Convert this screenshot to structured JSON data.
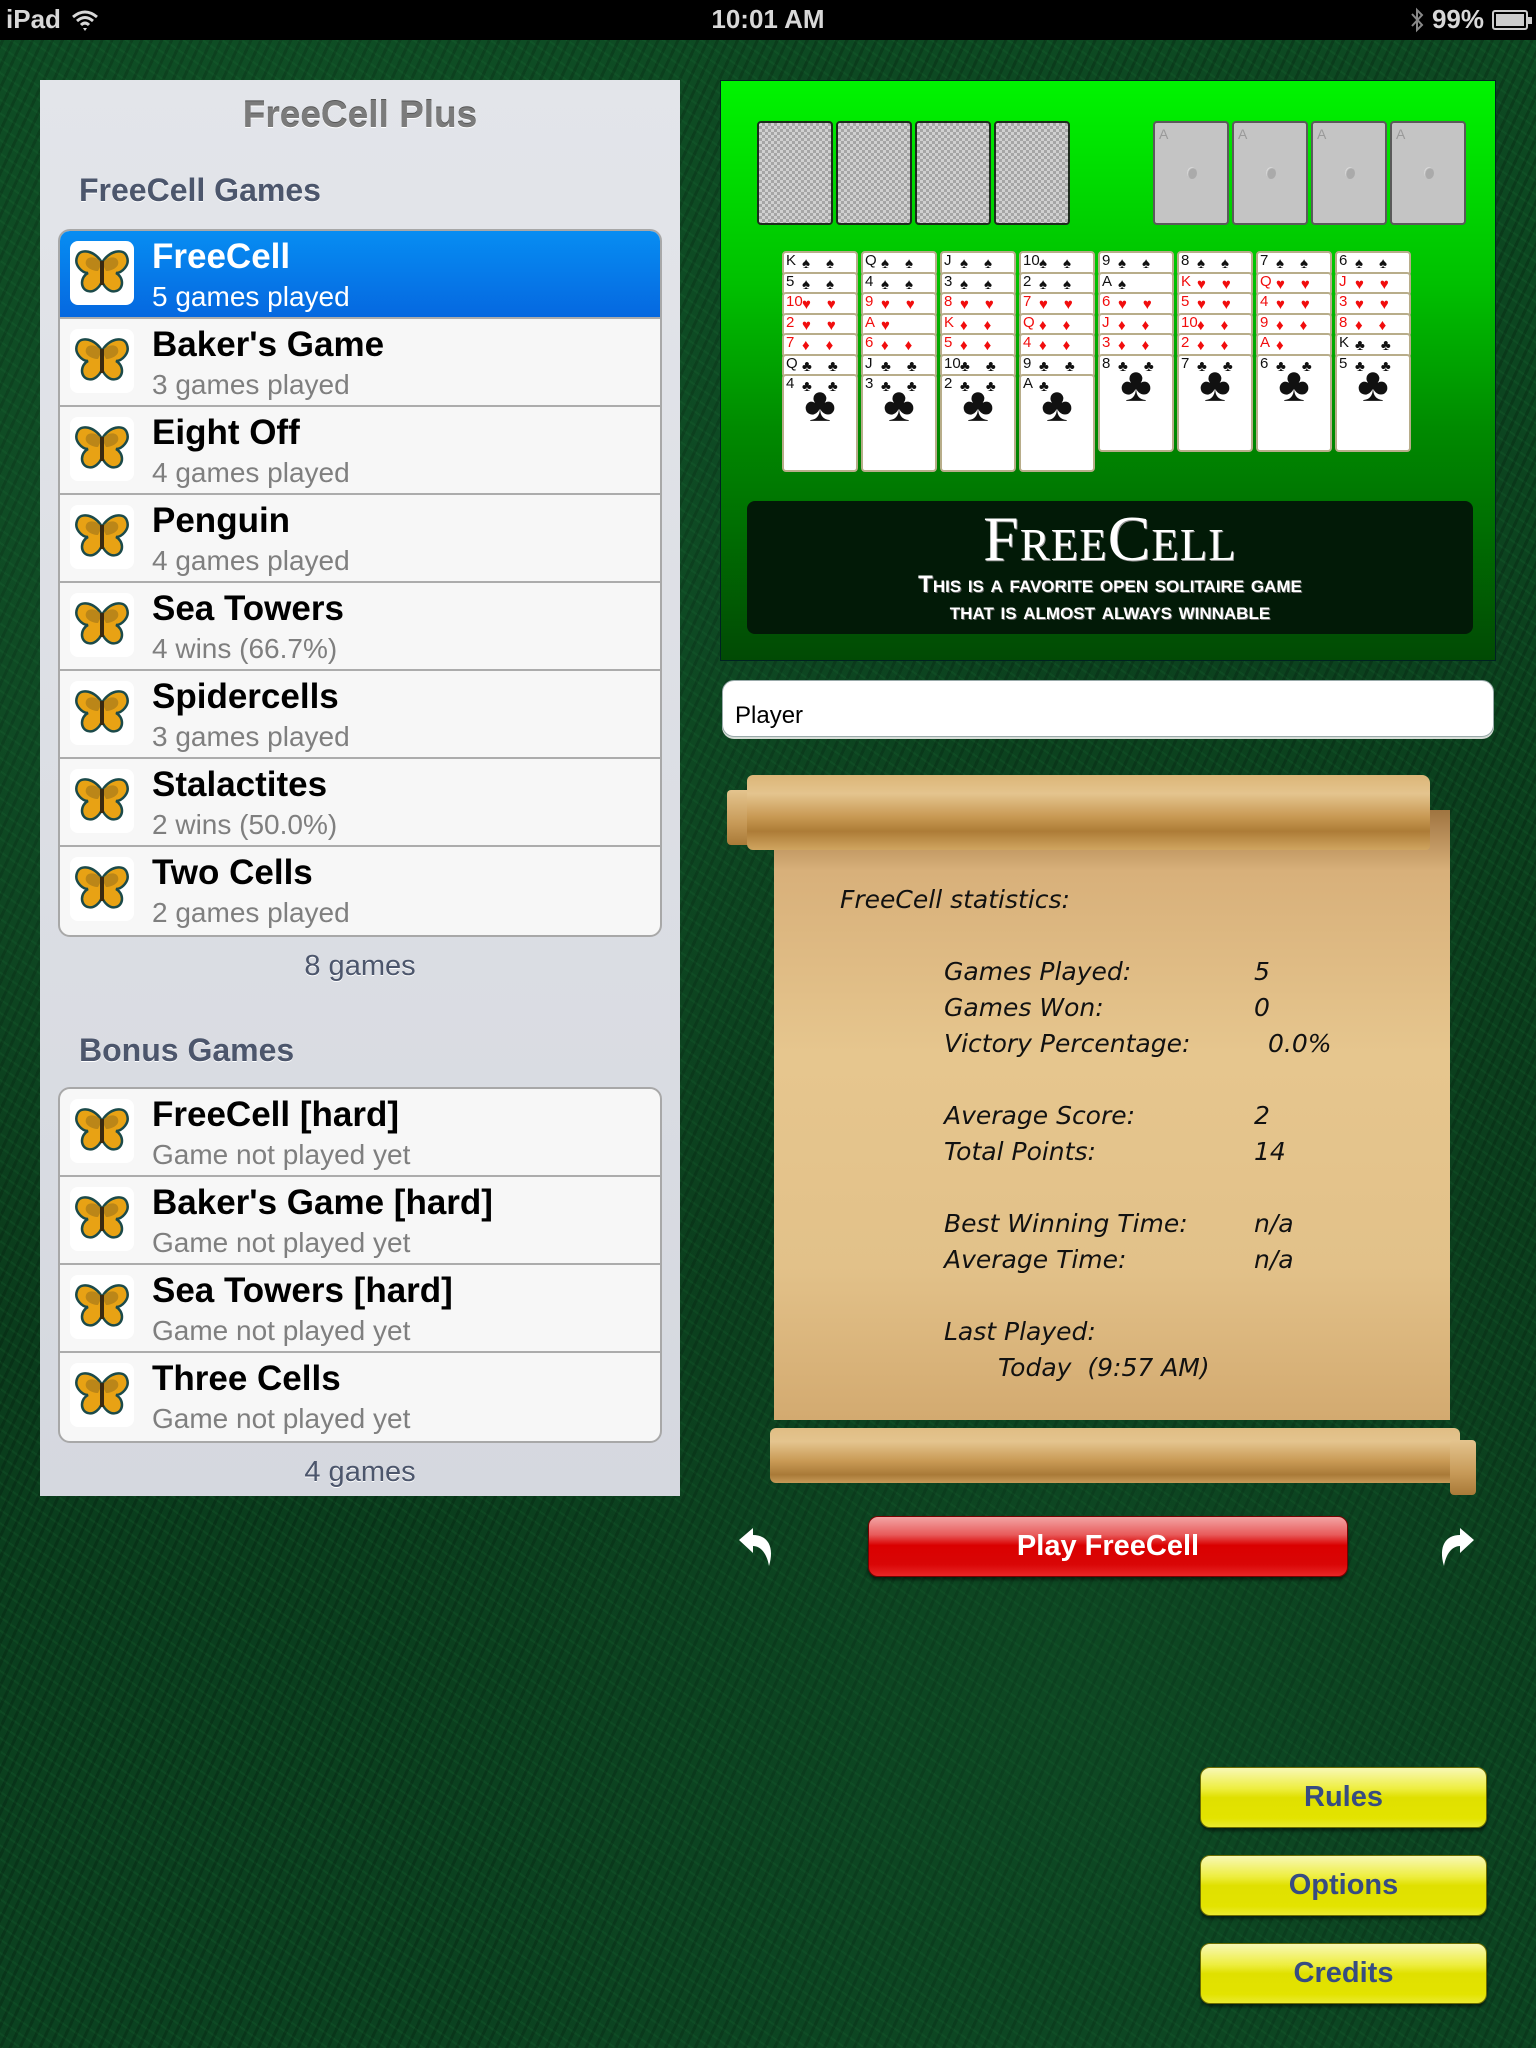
{
  "status_bar": {
    "device": "iPad",
    "time": "10:01 AM",
    "battery": "99%",
    "battery_level": 0.99,
    "icons": [
      "wifi-icon",
      "bluetooth-icon",
      "battery-icon"
    ]
  },
  "panel": {
    "title": "FreeCell Plus",
    "sections": [
      {
        "header": "FreeCell Games",
        "footer": "8 games",
        "items": [
          {
            "name": "FreeCell",
            "detail": "5 games played",
            "selected": true,
            "icon": "butterfly-icon"
          },
          {
            "name": "Baker's Game",
            "detail": "3 games played",
            "selected": false,
            "icon": "butterfly-icon"
          },
          {
            "name": "Eight Off",
            "detail": "4 games played",
            "selected": false,
            "icon": "butterfly-icon"
          },
          {
            "name": "Penguin",
            "detail": "4 games played",
            "selected": false,
            "icon": "butterfly-icon"
          },
          {
            "name": "Sea Towers",
            "detail": "4 wins (66.7%)",
            "selected": false,
            "icon": "butterfly-icon"
          },
          {
            "name": "Spidercells",
            "detail": "3 games played",
            "selected": false,
            "icon": "butterfly-icon"
          },
          {
            "name": "Stalactites",
            "detail": "2 wins (50.0%)",
            "selected": false,
            "icon": "butterfly-icon"
          },
          {
            "name": "Two Cells",
            "detail": "2 games played",
            "selected": false,
            "icon": "butterfly-icon"
          }
        ]
      },
      {
        "header": "Bonus Games",
        "footer": "4 games",
        "items": [
          {
            "name": "FreeCell [hard]",
            "detail": "Game not played yet",
            "selected": false,
            "icon": "butterfly-icon"
          },
          {
            "name": "Baker's Game [hard]",
            "detail": "Game not played yet",
            "selected": false,
            "icon": "butterfly-icon"
          },
          {
            "name": "Sea Towers [hard]",
            "detail": "Game not played yet",
            "selected": false,
            "icon": "butterfly-icon"
          },
          {
            "name": "Three Cells",
            "detail": "Game not played yet",
            "selected": false,
            "icon": "butterfly-icon"
          }
        ]
      }
    ]
  },
  "preview": {
    "free_cells": 4,
    "foundations": [
      "A",
      "A",
      "A",
      "A"
    ],
    "columns": [
      [
        "K♠",
        "5♠",
        "10♥",
        "2♥",
        "7♦",
        "Q♣",
        "4♣"
      ],
      [
        "Q♠",
        "4♠",
        "9♥",
        "A♥",
        "6♦",
        "J♣",
        "3♣"
      ],
      [
        "J♠",
        "3♠",
        "8♥",
        "K♦",
        "5♦",
        "10♣",
        "2♣"
      ],
      [
        "10♠",
        "2♠",
        "7♥",
        "Q♦",
        "4♦",
        "9♣",
        "A♣"
      ],
      [
        "9♠",
        "A♠",
        "6♥",
        "J♦",
        "3♦",
        "8♣"
      ],
      [
        "8♠",
        "K♥",
        "5♥",
        "10♦",
        "2♦",
        "7♣"
      ],
      [
        "7♠",
        "Q♥",
        "4♥",
        "9♦",
        "A♦",
        "6♣"
      ],
      [
        "6♠",
        "J♥",
        "3♥",
        "8♦",
        "K♣",
        "5♣"
      ]
    ],
    "banner_title": "FreeCell",
    "banner_line1": "This is a favorite open solitaire game",
    "banner_line2": "that is almost always winnable"
  },
  "player": {
    "value": "Player"
  },
  "stats": {
    "title": "FreeCell statistics:",
    "games_played_label": "Games Played:",
    "games_played": "5",
    "games_won_label": "Games Won:",
    "games_won": "0",
    "victory_label": "Victory Percentage:",
    "victory": "0.0%",
    "avg_score_label": "Average Score:",
    "avg_score": "2",
    "total_points_label": "Total Points:",
    "total_points": "14",
    "best_time_label": "Best Winning Time:",
    "best_time": "n/a",
    "avg_time_label": "Average Time:",
    "avg_time": "n/a",
    "last_played_label": "Last Played:",
    "last_played": "Today  (9:57 AM)"
  },
  "actions": {
    "play": "Play FreeCell",
    "rules": "Rules",
    "options": "Options",
    "credits": "Credits"
  },
  "colors": {
    "selected_row": "#0568e0",
    "play_button": "#da0000",
    "yellow_button": "#e0e000",
    "yellow_button_text": "#374c82",
    "felt": "#0a3d1c"
  }
}
